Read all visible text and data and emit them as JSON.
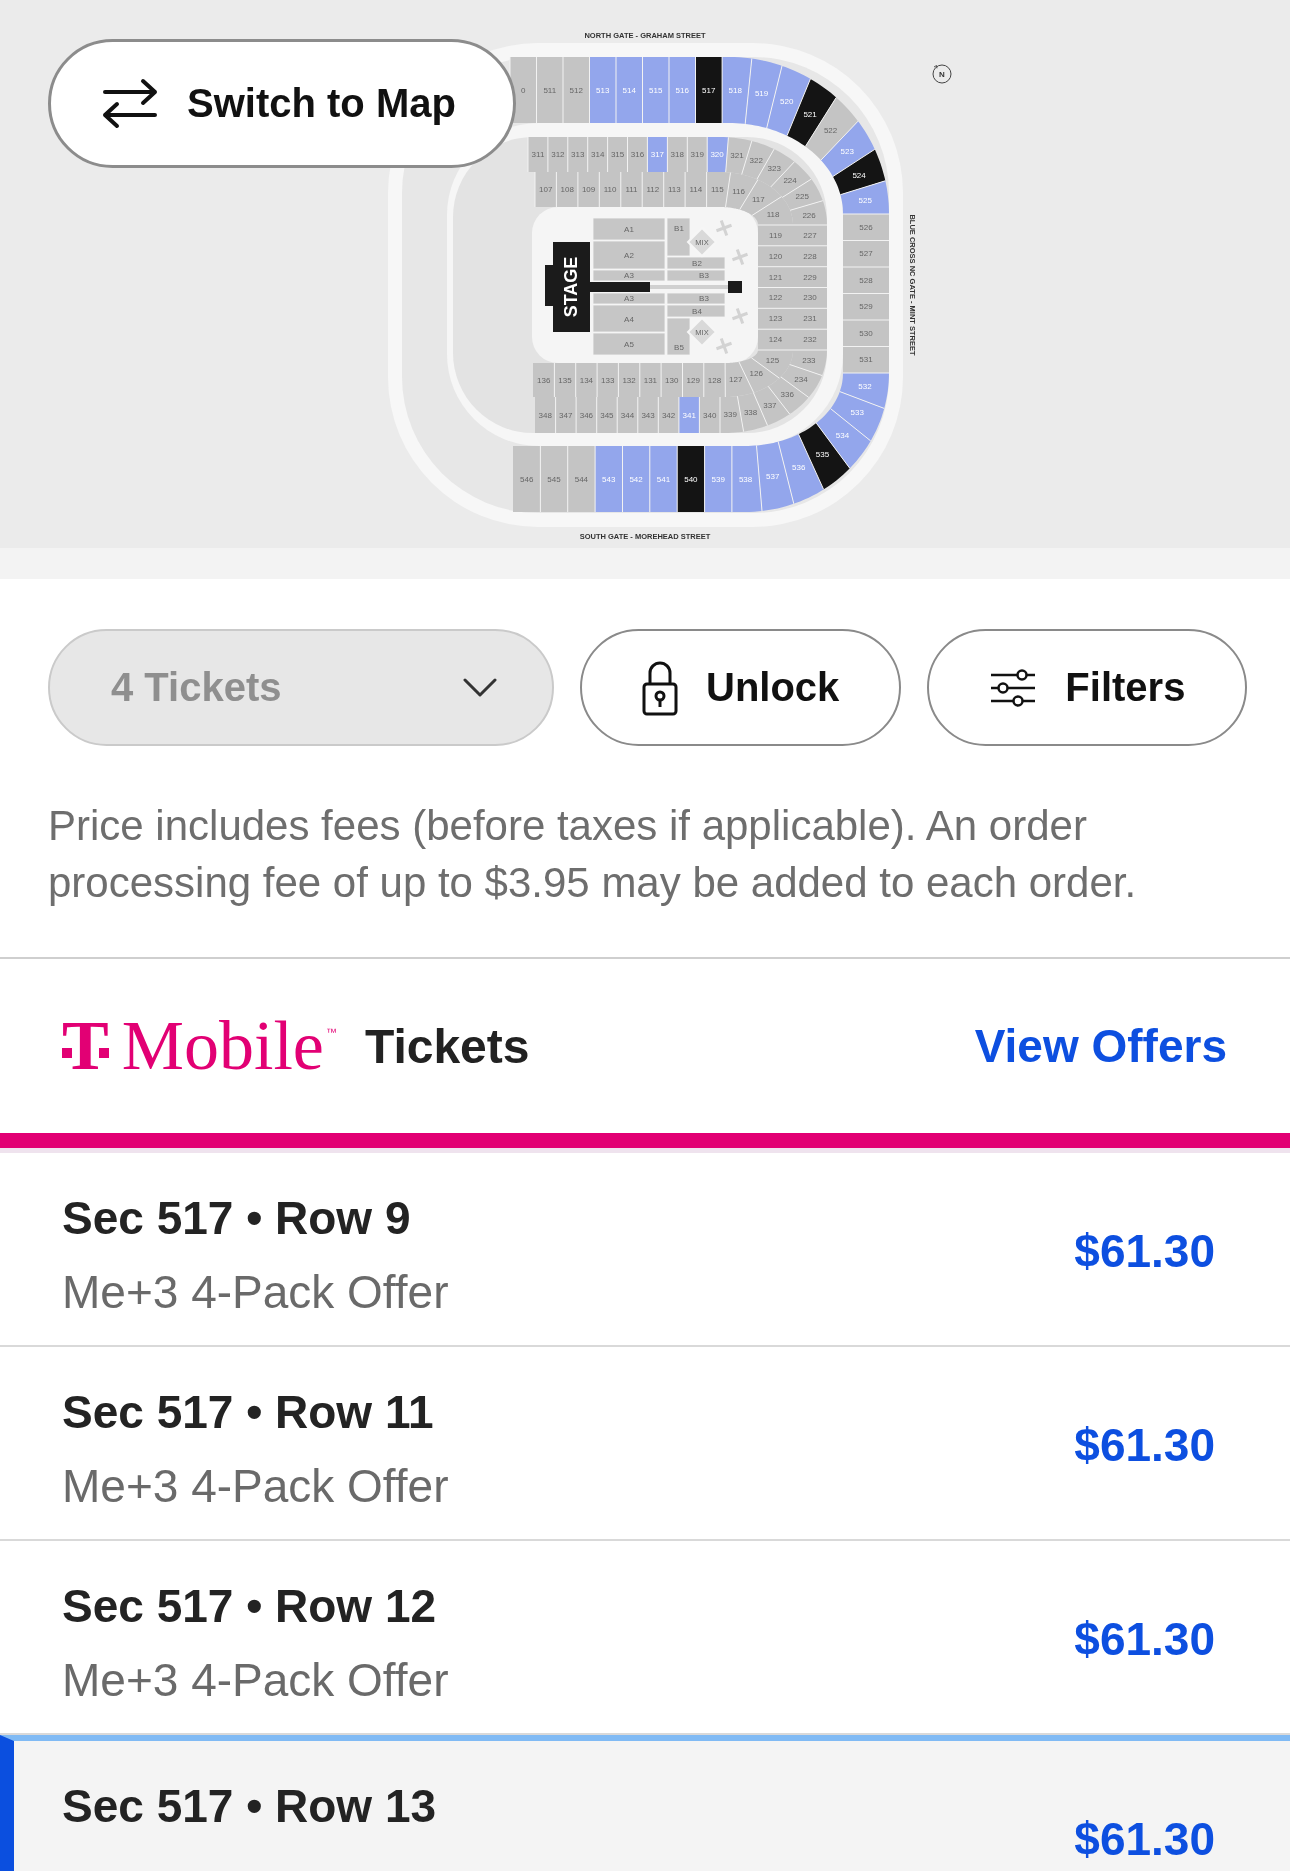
{
  "map": {
    "switch_button": "Switch to Map",
    "north_gate": "NORTH GATE - GRAHAM STREET",
    "east_gate": "BLUE CROSS NC GATE - MINT STREET",
    "south_gate": "SOUTH GATE - MOREHEAD STREET",
    "compass": "N",
    "tiers": [
      {
        "north": [
          {
            "label": "0",
            "color": "#c4c4c4"
          },
          {
            "label": "511",
            "color": "#c4c4c4"
          },
          {
            "label": "512",
            "color": "#c4c4c4"
          },
          {
            "label": "513",
            "color": "#93a6ec"
          },
          {
            "label": "514",
            "color": "#93a6ec"
          },
          {
            "label": "515",
            "color": "#93a6ec"
          },
          {
            "label": "516",
            "color": "#93a6ec"
          },
          {
            "label": "517",
            "color": "#141414"
          },
          {
            "label": "518",
            "color": "#93a6ec"
          },
          {
            "label": "519",
            "color": "#93a6ec"
          },
          {
            "label": "520",
            "color": "#93a6ec"
          },
          {
            "label": "521",
            "color": "#141414"
          },
          {
            "label": "522",
            "color": "#c4c4c4"
          },
          {
            "label": "523",
            "color": "#93a6ec"
          },
          {
            "label": "524",
            "color": "#141414"
          },
          {
            "label": "525",
            "color": "#93a6ec"
          }
        ],
        "east": [
          {
            "label": "526",
            "color": "#c4c4c4"
          },
          {
            "label": "527",
            "color": "#c4c4c4"
          },
          {
            "label": "528",
            "color": "#c4c4c4"
          },
          {
            "label": "529",
            "color": "#c4c4c4"
          },
          {
            "label": "530",
            "color": "#c4c4c4"
          },
          {
            "label": "531",
            "color": "#c4c4c4"
          }
        ],
        "south": [
          {
            "label": "546",
            "color": "#c4c4c4"
          },
          {
            "label": "545",
            "color": "#c4c4c4"
          },
          {
            "label": "544",
            "color": "#c4c4c4"
          },
          {
            "label": "543",
            "color": "#93a6ec"
          },
          {
            "label": "542",
            "color": "#93a6ec"
          },
          {
            "label": "541",
            "color": "#93a6ec"
          },
          {
            "label": "540",
            "color": "#141414"
          },
          {
            "label": "539",
            "color": "#93a6ec"
          },
          {
            "label": "538",
            "color": "#93a6ec"
          },
          {
            "label": "537",
            "color": "#93a6ec"
          },
          {
            "label": "536",
            "color": "#93a6ec"
          },
          {
            "label": "535",
            "color": "#141414"
          },
          {
            "label": "534",
            "color": "#93a6ec"
          },
          {
            "label": "533",
            "color": "#93a6ec"
          },
          {
            "label": "532",
            "color": "#93a6ec"
          }
        ]
      },
      {
        "north": [
          {
            "label": "311",
            "color": "#c4c4c4"
          },
          {
            "label": "312",
            "color": "#c4c4c4"
          },
          {
            "label": "313",
            "color": "#c4c4c4"
          },
          {
            "label": "314",
            "color": "#c4c4c4"
          },
          {
            "label": "315",
            "color": "#c4c4c4"
          },
          {
            "label": "316",
            "color": "#c4c4c4"
          },
          {
            "label": "317",
            "color": "#93a6ec"
          },
          {
            "label": "318",
            "color": "#c4c4c4"
          },
          {
            "label": "319",
            "color": "#c4c4c4"
          },
          {
            "label": "320",
            "color": "#93a6ec"
          },
          {
            "label": "321",
            "color": "#c4c4c4"
          },
          {
            "label": "322",
            "color": "#c4c4c4"
          },
          {
            "label": "323",
            "color": "#c4c4c4"
          },
          {
            "label": "224",
            "color": "#c4c4c4"
          },
          {
            "label": "225",
            "color": "#c4c4c4"
          },
          {
            "label": "226",
            "color": "#c4c4c4"
          }
        ],
        "east": [
          {
            "label": "227",
            "color": "#c4c4c4"
          },
          {
            "label": "228",
            "color": "#c4c4c4"
          },
          {
            "label": "229",
            "color": "#c4c4c4"
          },
          {
            "label": "230",
            "color": "#c4c4c4"
          },
          {
            "label": "231",
            "color": "#c4c4c4"
          },
          {
            "label": "232",
            "color": "#c4c4c4"
          }
        ],
        "south": [
          {
            "label": "348",
            "color": "#c4c4c4"
          },
          {
            "label": "347",
            "color": "#c4c4c4"
          },
          {
            "label": "346",
            "color": "#c4c4c4"
          },
          {
            "label": "345",
            "color": "#c4c4c4"
          },
          {
            "label": "344",
            "color": "#c4c4c4"
          },
          {
            "label": "343",
            "color": "#c4c4c4"
          },
          {
            "label": "342",
            "color": "#c4c4c4"
          },
          {
            "label": "341",
            "color": "#93a6ec"
          },
          {
            "label": "340",
            "color": "#c4c4c4"
          },
          {
            "label": "339",
            "color": "#c4c4c4"
          },
          {
            "label": "338",
            "color": "#c4c4c4"
          },
          {
            "label": "337",
            "color": "#c4c4c4"
          },
          {
            "label": "336",
            "color": "#c4c4c4"
          },
          {
            "label": "234",
            "color": "#c4c4c4"
          },
          {
            "label": "233",
            "color": "#c4c4c4"
          }
        ]
      },
      {
        "north": [
          {
            "label": "107"
          },
          {
            "label": "108"
          },
          {
            "label": "109"
          },
          {
            "label": "110"
          },
          {
            "label": "111"
          },
          {
            "label": "112"
          },
          {
            "label": "113"
          },
          {
            "label": "114"
          },
          {
            "label": "115"
          },
          {
            "label": "116"
          },
          {
            "label": "117"
          },
          {
            "label": "118"
          }
        ],
        "east": [
          {
            "label": "119"
          },
          {
            "label": "120"
          },
          {
            "label": "121"
          },
          {
            "label": "122"
          },
          {
            "label": "123"
          },
          {
            "label": "124"
          }
        ],
        "south": [
          {
            "label": "136"
          },
          {
            "label": "135"
          },
          {
            "label": "134"
          },
          {
            "label": "133"
          },
          {
            "label": "132"
          },
          {
            "label": "131"
          },
          {
            "label": "130"
          },
          {
            "label": "129"
          },
          {
            "label": "128"
          },
          {
            "label": "127"
          },
          {
            "label": "126"
          },
          {
            "label": "125"
          }
        ]
      }
    ],
    "floor": {
      "stage": "STAGE",
      "blocks": [
        "A1",
        "A2",
        "A3",
        "A3",
        "A4",
        "A5",
        "B1",
        "B2",
        "B3",
        "B3",
        "B4",
        "B5"
      ],
      "mix": [
        "MIX",
        "MIX"
      ]
    }
  },
  "controls": {
    "quantity": {
      "value": "4 Tickets",
      "disabled": true
    },
    "actions": [
      {
        "kind": "lock",
        "label": "Unlock"
      },
      {
        "kind": "filters",
        "label": "Filters"
      }
    ]
  },
  "disclaimer": "Price includes fees (before taxes if applicable). An order processing fee of up to $3.95 may be added to each order.",
  "offers": {
    "logo_mark": "T",
    "logo_word": "Mobile",
    "trademark": "™",
    "title": "Tickets",
    "link": "View Offers",
    "listings": [
      {
        "title": "Sec 517 • Row 9",
        "subtitle": "Me+3 4-Pack Offer",
        "price": "$61.30",
        "selected": false
      },
      {
        "title": "Sec 517 • Row 11",
        "subtitle": "Me+3 4-Pack Offer",
        "price": "$61.30",
        "selected": false
      },
      {
        "title": "Sec 517 • Row 12",
        "subtitle": "Me+3 4-Pack Offer",
        "price": "$61.30",
        "selected": false
      },
      {
        "title": "Sec 517 • Row 13",
        "price": "$61.30",
        "selected": true
      }
    ]
  }
}
